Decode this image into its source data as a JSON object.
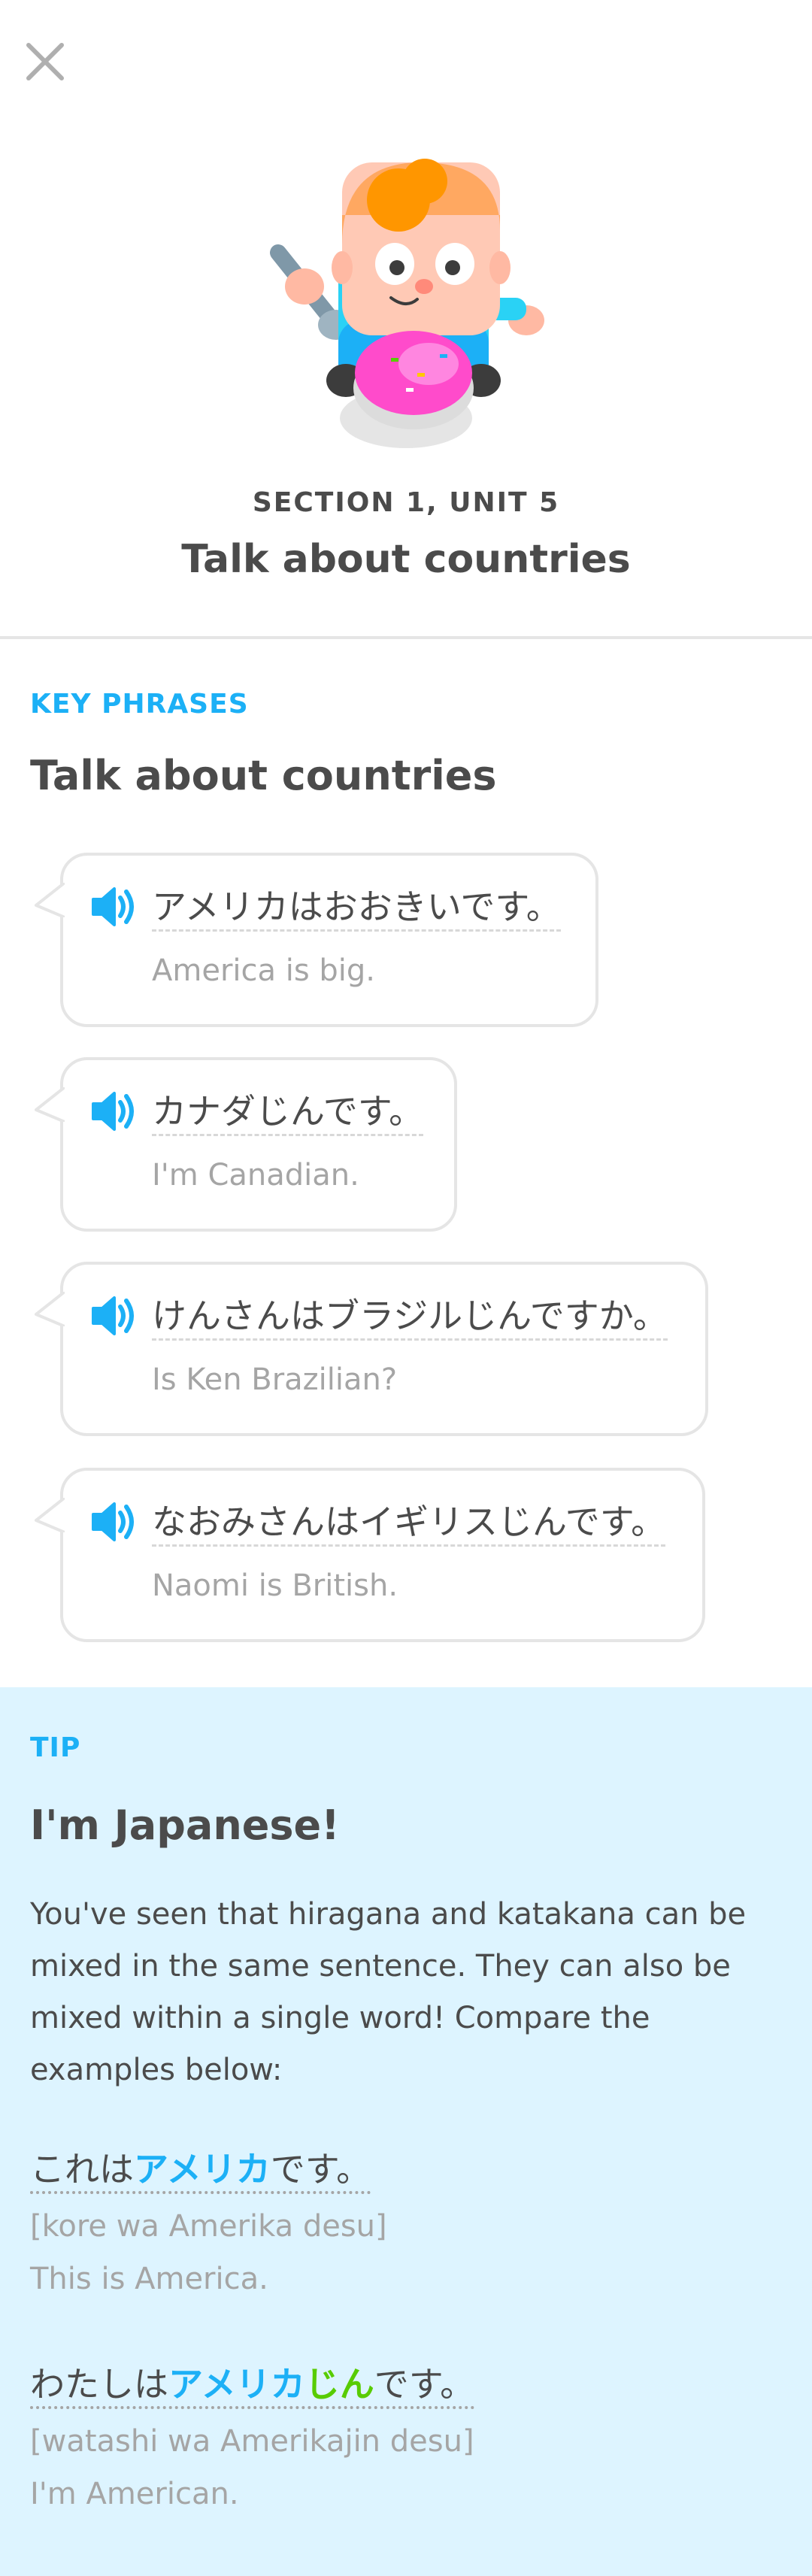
{
  "header": {
    "section_unit": "SECTION 1, UNIT 5",
    "title": "Talk about countries"
  },
  "icons": {
    "close": "close-icon",
    "speaker": "speaker-icon",
    "mascot": "character-with-ice-cream"
  },
  "key_phrases": {
    "label": "KEY PHRASES",
    "title": "Talk about countries",
    "phrases": [
      {
        "jp": "アメリカはおおきいです。",
        "en": "America is big."
      },
      {
        "jp": "カナダじんです。",
        "en": "I'm Canadian."
      },
      {
        "jp": "けんさんはブラジルじんですか。",
        "en": "Is Ken Brazilian?"
      },
      {
        "jp": "なおみさんはイギリスじんです。",
        "en": "Naomi is British."
      }
    ]
  },
  "tip": {
    "label": "TIP",
    "title": "I'm Japanese!",
    "body": "You've seen that hiragana and katakana can be mixed in the same sentence. They can also be mixed within a single word! Compare the examples below:",
    "examples": [
      {
        "jp_before": "これは",
        "jp_katakana": "アメリカ",
        "jp_hiragana": "",
        "jp_after": "です。",
        "romaji": "[kore wa Amerika desu]",
        "en": "This is America."
      },
      {
        "jp_before": "わたしは",
        "jp_katakana": "アメリカ",
        "jp_hiragana": "じん",
        "jp_after": "です。",
        "romaji": "[watashi wa Amerikajin desu]",
        "en": "I'm American."
      }
    ]
  },
  "colors": {
    "accent_blue": "#1cb0f6",
    "accent_green": "#58cc02",
    "tip_background": "#ddf4ff",
    "text_primary": "#4b4b4b",
    "text_secondary": "#a5a5a5"
  }
}
